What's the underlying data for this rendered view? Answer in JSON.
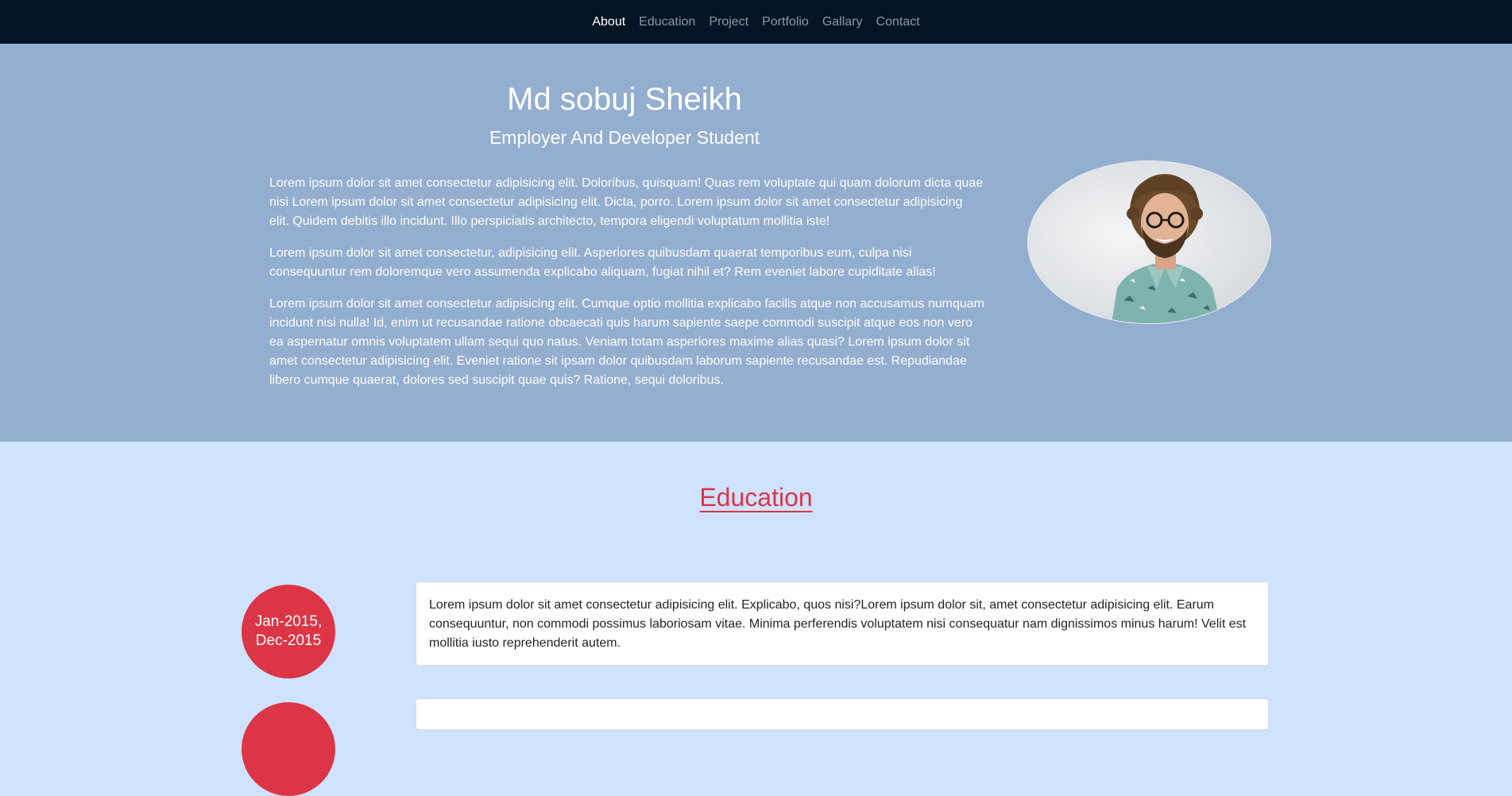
{
  "nav": {
    "items": [
      {
        "label": "About",
        "active": true
      },
      {
        "label": "Education",
        "active": false
      },
      {
        "label": "Project",
        "active": false
      },
      {
        "label": "Portfolio",
        "active": false
      },
      {
        "label": "Gallary",
        "active": false
      },
      {
        "label": "Contact",
        "active": false
      }
    ]
  },
  "hero": {
    "name": "Md sobuj Sheikh",
    "subtitle": "Employer And Developer Student",
    "paragraphs": [
      "Lorem ipsum dolor sit amet consectetur adipisicing elit. Doloribus, quisquam! Quas rem voluptate qui quam dolorum dicta quae nisi Lorem ipsum dolor sit amet consectetur adipisicing elit. Dicta, porro. Lorem ipsum dolor sit amet consectetur adipisicing elit. Quidem debitis illo incidunt. Illo perspiciatis architecto, tempora eligendi voluptatum mollitia iste!",
      "Lorem ipsum dolor sit amet consectetur, adipisicing elit. Asperiores quibusdam quaerat temporibus eum, culpa nisi consequuntur rem doloremque vero assumenda explicabo aliquam, fugiat nihil et? Rem eveniet labore cupiditate alias!",
      "Lorem ipsum dolor sit amet consectetur adipisicing elit. Cumque optio mollitia explicabo facilis atque non accusamus numquam incidunt nisi nulla! Id, enim ut recusandae ratione obcaecati quis harum sapiente saepe commodi suscipit atque eos non vero ea aspernatur omnis voluptatem ullam sequi quo natus. Veniam totam asperiores maxime alias quasi? Lorem ipsum dolor sit amet consectetur adipisicing elit. Eveniet ratione sit ipsam dolor quibusdam laborum sapiente recusandae est. Repudiandae libero cumque quaerat, dolores sed suscipit quae quis? Ratione, sequi doloribus."
    ]
  },
  "education": {
    "heading": "Education",
    "entries": [
      {
        "date_line1": "Jan-2015,",
        "date_line2": "Dec-2015",
        "text": "Lorem ipsum dolor sit amet consectetur adipisicing elit. Explicabo, quos nisi?Lorem ipsum dolor sit, amet consectetur adipisicing elit. Earum consequuntur, non commodi possimus laboriosam vitae. Minima perferendis voluptatem nisi consequatur nam dignissimos minus harum! Velit est mollitia iusto reprehenderit autem."
      },
      {
        "date_line1": "",
        "date_line2": "",
        "text": ""
      }
    ]
  },
  "colors": {
    "navbar_bg": "#031525",
    "hero_bg": "#93aecf",
    "section_bg": "#cfe2ff",
    "accent": "#dc3545"
  }
}
